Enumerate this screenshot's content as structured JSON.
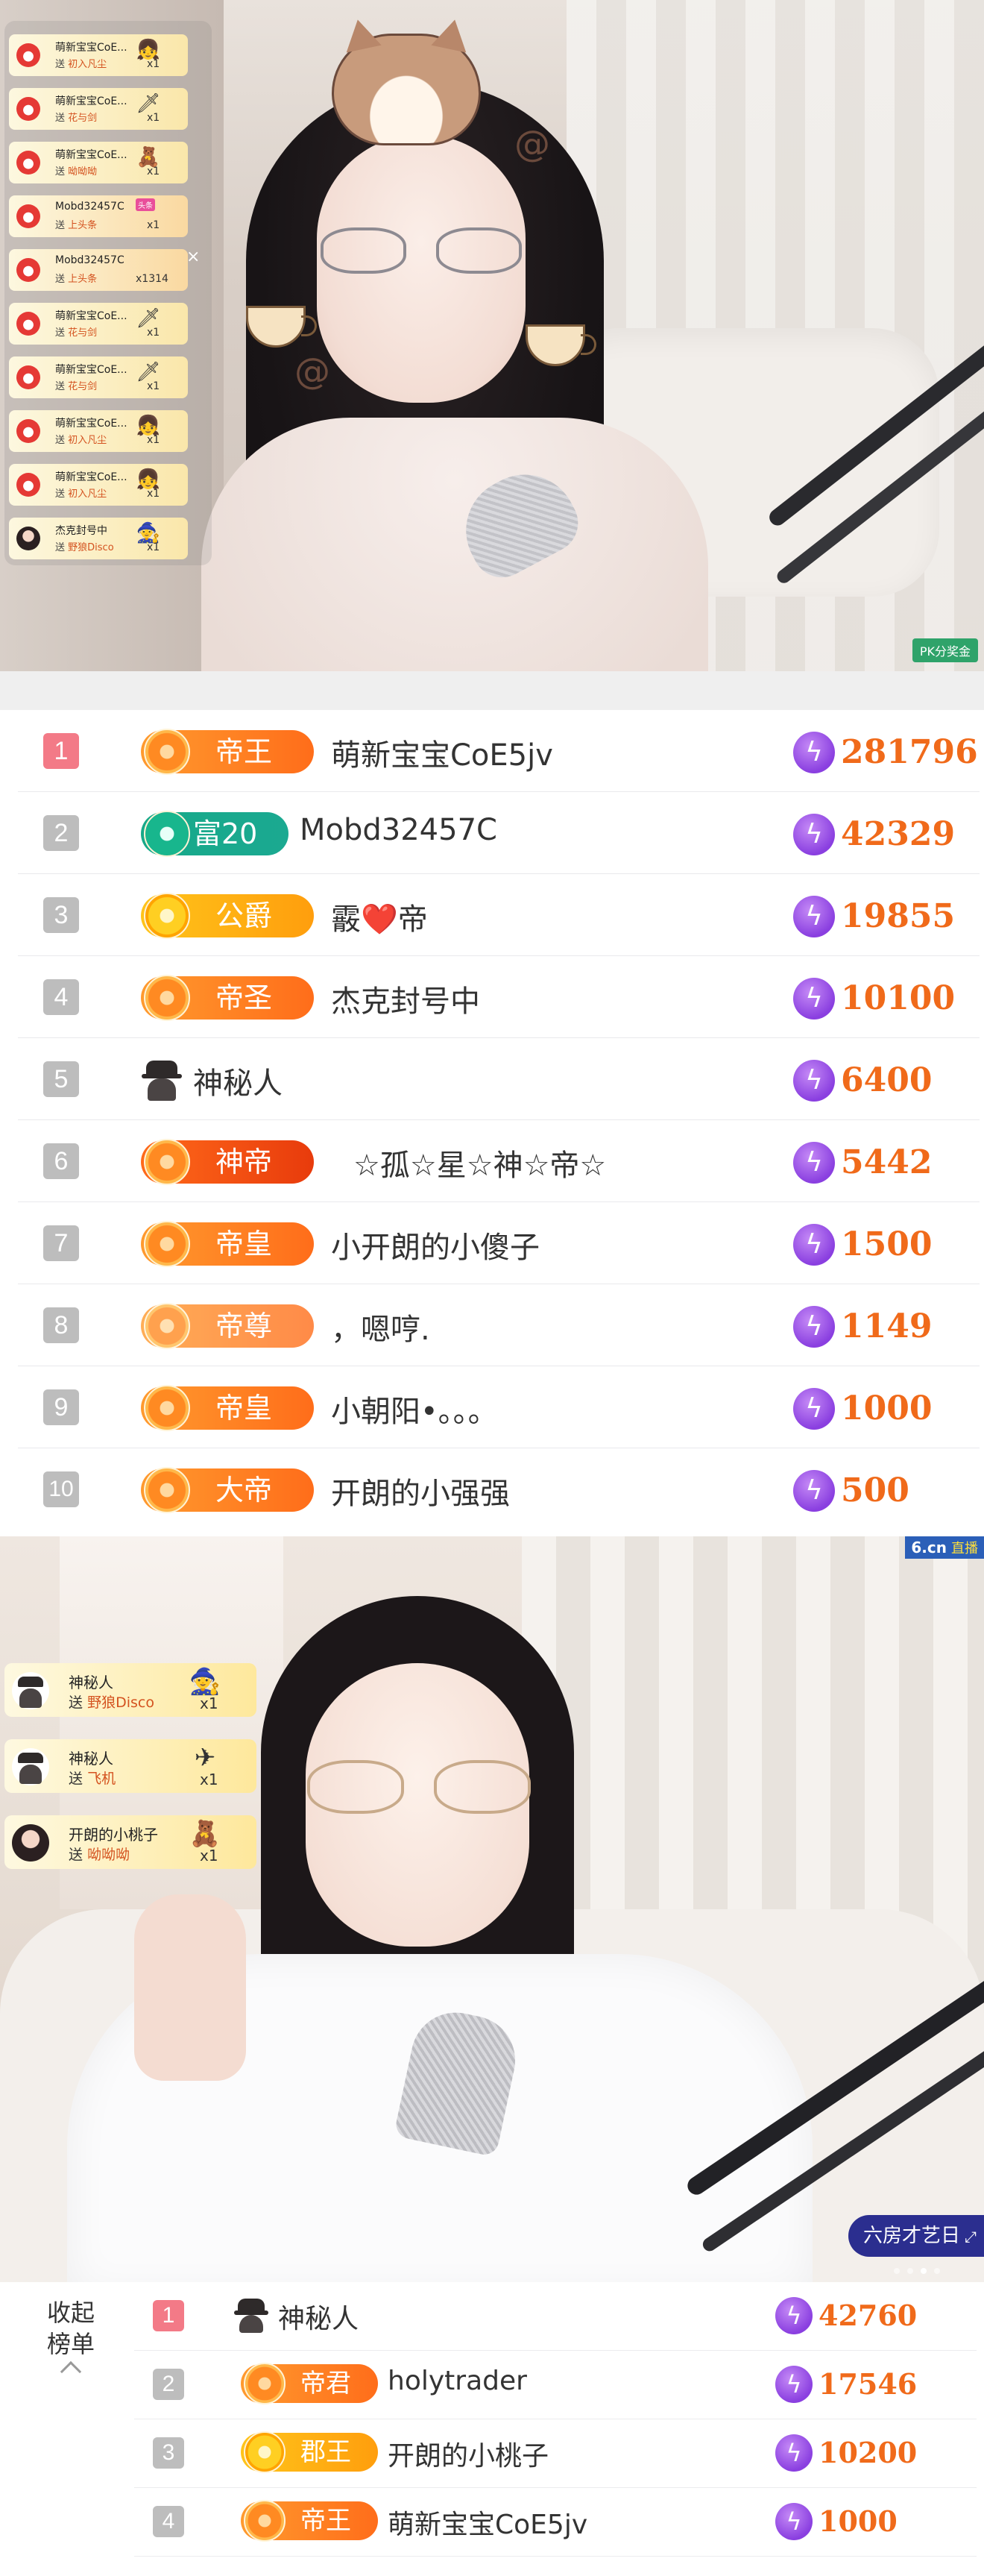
{
  "stream1": {
    "gift_feed": [
      {
        "user": "萌新宝宝CoE...",
        "action": "送",
        "gift": "初入凡尘",
        "qty": "x1",
        "icon": "👧"
      },
      {
        "user": "萌新宝宝CoE...",
        "action": "送",
        "gift": "花与剑",
        "qty": "x1",
        "icon": "🗡"
      },
      {
        "user": "萌新宝宝CoE...",
        "action": "送",
        "gift": "呦呦呦",
        "qty": "x1",
        "icon": "🧸"
      },
      {
        "user": "Mobd32457C",
        "action": "送",
        "gift": "上头条",
        "qty": "x1",
        "tag": "头条",
        "icon": ""
      },
      {
        "user": "Mobd32457C",
        "action": "送",
        "gift": "上头条",
        "qty": "x1314",
        "icon": ""
      },
      {
        "user": "萌新宝宝CoE...",
        "action": "送",
        "gift": "花与剑",
        "qty": "x1",
        "icon": "🗡"
      },
      {
        "user": "萌新宝宝CoE...",
        "action": "送",
        "gift": "花与剑",
        "qty": "x1",
        "icon": "🗡"
      },
      {
        "user": "萌新宝宝CoE...",
        "action": "送",
        "gift": "初入凡尘",
        "qty": "x1",
        "icon": "👧"
      },
      {
        "user": "萌新宝宝CoE...",
        "action": "送",
        "gift": "初入凡尘",
        "qty": "x1",
        "icon": "👧"
      },
      {
        "user": "杰克封号中",
        "action": "送",
        "gift": "野狼Disco",
        "qty": "x1",
        "icon": "🧙"
      }
    ],
    "close_label": "×",
    "pk_label": "PK分奖金"
  },
  "board1": {
    "rows": [
      {
        "rank": "1",
        "badge": "帝王",
        "user": "萌新宝宝CoE5jv",
        "amount": "281796"
      },
      {
        "rank": "2",
        "badge": "富20",
        "user": "Mobd32457C",
        "amount": "42329"
      },
      {
        "rank": "3",
        "badge": "公爵",
        "user": "霰❤️帝",
        "amount": "19855"
      },
      {
        "rank": "4",
        "badge": "帝圣",
        "user": "杰克封号中",
        "amount": "10100"
      },
      {
        "rank": "5",
        "badge": "",
        "user": "神秘人",
        "amount": "6400"
      },
      {
        "rank": "6",
        "badge": "神帝",
        "user": "☆孤☆星☆神☆帝☆",
        "amount": "5442"
      },
      {
        "rank": "7",
        "badge": "帝皇",
        "user": "小开朗的小傻子",
        "amount": "1500"
      },
      {
        "rank": "8",
        "badge": "帝尊",
        "user": "，嗯哼.",
        "amount": "1149"
      },
      {
        "rank": "9",
        "badge": "帝皇",
        "user": "小朝阳•。。。",
        "amount": "1000"
      },
      {
        "rank": "10",
        "badge": "大帝",
        "user": "开朗的小强强",
        "amount": "500"
      }
    ]
  },
  "stream2": {
    "logo": "6.cn",
    "logo_suffix": "直播",
    "gift_feed": [
      {
        "user": "神秘人",
        "action": "送",
        "gift": "野狼Disco",
        "qty": "x1",
        "icon": "🧙"
      },
      {
        "user": "神秘人",
        "action": "送",
        "gift": "飞机",
        "qty": "x1",
        "icon": "✈"
      },
      {
        "user": "开朗的小桃子",
        "action": "送",
        "gift": "呦呦呦",
        "qty": "x1",
        "icon": "🧸"
      }
    ],
    "room_tag": "六房才艺日",
    "room_tag_icon": "⤢"
  },
  "board2": {
    "collapse_label_1": "收起",
    "collapse_label_2": "榜单",
    "rows": [
      {
        "rank": "1",
        "badge": "",
        "user": "神秘人",
        "amount": "42760"
      },
      {
        "rank": "2",
        "badge": "帝君",
        "user": "holytrader",
        "amount": "17546"
      },
      {
        "rank": "3",
        "badge": "郡王",
        "user": "开朗的小桃子",
        "amount": "10200"
      },
      {
        "rank": "4",
        "badge": "帝王",
        "user": "萌新宝宝CoE5jv",
        "amount": "1000"
      }
    ]
  },
  "icons": {
    "currency": "lightning-coin-icon",
    "anonymous": "mystery-user-icon"
  },
  "colors": {
    "rank_first": "#f37a87",
    "rank_other": "#bdbdbd",
    "amount": "#f06a1a",
    "badge_orange": "#ff7a1f",
    "badge_gold": "#ffb20d",
    "badge_teal": "#17a989"
  }
}
